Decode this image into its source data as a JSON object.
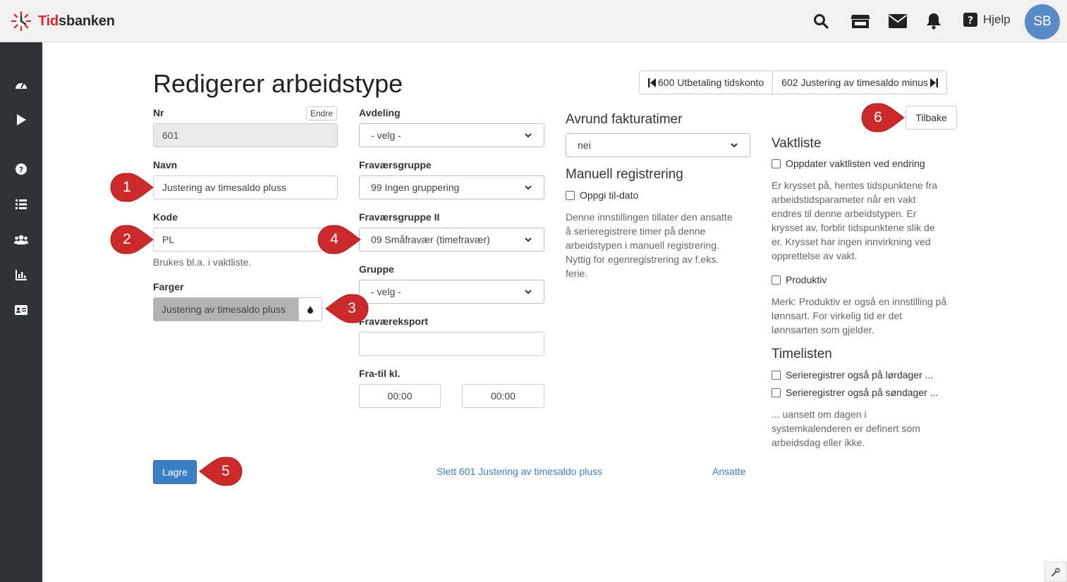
{
  "app": {
    "logo_red": "Tid",
    "logo_dark": "sbanken"
  },
  "header": {
    "help_label": "Hjelp",
    "avatar_initials": "SB"
  },
  "page": {
    "title": "Redigerer arbeidstype"
  },
  "pager": {
    "prev_label": "600 Utbetaling tidskonto",
    "next_label": "602 Justering av timesaldo minus"
  },
  "form": {
    "nr": {
      "label": "Nr",
      "value": "601",
      "change_label": "Endre"
    },
    "navn": {
      "label": "Navn",
      "value": "Justering av timesaldo pluss"
    },
    "kode": {
      "label": "Kode",
      "value": "PL",
      "help": "Brukes bl.a. i vaktliste."
    },
    "farger": {
      "label": "Farger",
      "value": "Justering av timesaldo pluss"
    },
    "avdeling": {
      "label": "Avdeling",
      "value": "- velg -"
    },
    "fravaersgruppe": {
      "label": "Fraværsgruppe",
      "value": "99 Ingen gruppering"
    },
    "fravaersgruppe2": {
      "label": "Fraværsgruppe II",
      "value": "09 Småfravær (timefravær)"
    },
    "gruppe": {
      "label": "Gruppe",
      "value": "- velg -"
    },
    "fravaereksport": {
      "label": "Fraværeksport",
      "value": ""
    },
    "fratil": {
      "label": "Fra-til kl.",
      "from": "00:00",
      "to": "00:00"
    }
  },
  "middle": {
    "avrund": {
      "title": "Avrund fakturatimer",
      "value": "nei"
    },
    "manuell": {
      "title": "Manuell registrering",
      "checkbox": "Oppgi til-dato",
      "help": [
        "Denne innstillingen tillater den ansatte",
        "å serieregistrere timer på denne",
        "arbeidstypen i manuell registrering.",
        "Nyttig for egenregistrering av f.eks.",
        "ferie."
      ]
    }
  },
  "right": {
    "back_label": "Tilbake",
    "vaktliste": {
      "title": "Vaktliste",
      "checkbox": "Oppdater vaktlisten ved endring",
      "help": [
        "Er krysset på, hentes tidspunktene fra",
        "arbeidstidsparameter når en vakt",
        "endres til denne arbeidstypen. Er",
        "krysset av, forblir tidspunktene slik de",
        "er. Krysset har ingen innvirkning ved",
        "opprettelse av vakt."
      ]
    },
    "produktiv": {
      "checkbox": "Produktiv",
      "help": [
        "Merk: Produktiv er også en innstilling på",
        "lønnsart. For virkelig tid er det",
        "lønnsarten som gjelder."
      ]
    },
    "timelisten": {
      "title": "Timelisten",
      "checkbox_sat": "Serieregistrer også på lørdager ...",
      "checkbox_sun": "Serieregistrer også på søndager ...",
      "help": [
        "... uansett om dagen i",
        "systemkalenderen er definert som",
        "arbeidsdag eller ikke."
      ]
    }
  },
  "footer": {
    "save_label": "Lagre",
    "delete_link": "Slett 601 Justering av timesaldo pluss",
    "employees_link": "Ansatte"
  },
  "markers": [
    "1",
    "2",
    "3",
    "4",
    "5",
    "6"
  ],
  "colors": {
    "accent": "#3a7ec5",
    "marker": "#cc2a2a",
    "sidebar": "#2f3337",
    "swatch": "#b3b3b3"
  }
}
